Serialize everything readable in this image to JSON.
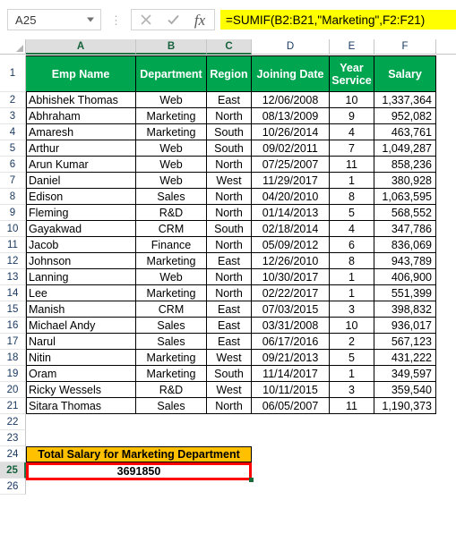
{
  "formula_bar": {
    "name_box_value": "A25",
    "cancel_icon": "cancel-x-icon",
    "confirm_icon": "confirm-check-icon",
    "fx_label": "fx",
    "formula": "=SUMIF(B2:B21,\"Marketing\",F2:F21)",
    "formula_placeholder": ""
  },
  "columns": [
    {
      "letter": "A",
      "selected": true
    },
    {
      "letter": "B",
      "selected": true
    },
    {
      "letter": "C",
      "selected": true
    },
    {
      "letter": "D",
      "selected": false
    },
    {
      "letter": "E",
      "selected": false
    },
    {
      "letter": "F",
      "selected": false
    }
  ],
  "row_numbers": [
    "1",
    "2",
    "3",
    "4",
    "5",
    "6",
    "7",
    "8",
    "9",
    "10",
    "11",
    "12",
    "13",
    "14",
    "15",
    "16",
    "17",
    "18",
    "19",
    "20",
    "21",
    "22",
    "23",
    "24",
    "25",
    "26"
  ],
  "selected_row": "25",
  "table": {
    "headers": [
      "Emp Name",
      "Department",
      "Region",
      "Joining Date",
      "Year Service",
      "Salary"
    ],
    "header_lines": [
      [
        "Emp Name"
      ],
      [
        "Department"
      ],
      [
        "Region"
      ],
      [
        "Joining Date"
      ],
      [
        "Year",
        "Service"
      ],
      [
        "Salary"
      ]
    ],
    "rows": [
      {
        "name": "Abhishek Thomas",
        "dept": "Web",
        "region": "East",
        "date": "12/06/2008",
        "years": "10",
        "salary": "1,337,364"
      },
      {
        "name": "Abhraham",
        "dept": "Marketing",
        "region": "North",
        "date": "08/13/2009",
        "years": "9",
        "salary": "952,082"
      },
      {
        "name": "Amaresh",
        "dept": "Marketing",
        "region": "South",
        "date": "10/26/2014",
        "years": "4",
        "salary": "463,761"
      },
      {
        "name": "Arthur",
        "dept": "Web",
        "region": "South",
        "date": "09/02/2011",
        "years": "7",
        "salary": "1,049,287"
      },
      {
        "name": "Arun Kumar",
        "dept": "Web",
        "region": "North",
        "date": "07/25/2007",
        "years": "11",
        "salary": "858,236"
      },
      {
        "name": "Daniel",
        "dept": "Web",
        "region": "West",
        "date": "11/29/2017",
        "years": "1",
        "salary": "380,928"
      },
      {
        "name": "Edison",
        "dept": "Sales",
        "region": "North",
        "date": "04/20/2010",
        "years": "8",
        "salary": "1,063,595"
      },
      {
        "name": "Fleming",
        "dept": "R&D",
        "region": "North",
        "date": "01/14/2013",
        "years": "5",
        "salary": "568,552"
      },
      {
        "name": "Gayakwad",
        "dept": "CRM",
        "region": "South",
        "date": "02/18/2014",
        "years": "4",
        "salary": "347,786"
      },
      {
        "name": "Jacob",
        "dept": "Finance",
        "region": "North",
        "date": "05/09/2012",
        "years": "6",
        "salary": "836,069"
      },
      {
        "name": "Johnson",
        "dept": "Marketing",
        "region": "East",
        "date": "12/26/2010",
        "years": "8",
        "salary": "943,789"
      },
      {
        "name": "Lanning",
        "dept": "Web",
        "region": "North",
        "date": "10/30/2017",
        "years": "1",
        "salary": "406,900"
      },
      {
        "name": "Lee",
        "dept": "Marketing",
        "region": "North",
        "date": "02/22/2017",
        "years": "1",
        "salary": "551,399"
      },
      {
        "name": "Manish",
        "dept": "CRM",
        "region": "East",
        "date": "07/03/2015",
        "years": "3",
        "salary": "398,832"
      },
      {
        "name": "Michael Andy",
        "dept": "Sales",
        "region": "East",
        "date": "03/31/2008",
        "years": "10",
        "salary": "936,017"
      },
      {
        "name": "Narul",
        "dept": "Sales",
        "region": "East",
        "date": "06/17/2016",
        "years": "2",
        "salary": "567,123"
      },
      {
        "name": "Nitin",
        "dept": "Marketing",
        "region": "West",
        "date": "09/21/2013",
        "years": "5",
        "salary": "431,222"
      },
      {
        "name": "Oram",
        "dept": "Marketing",
        "region": "South",
        "date": "11/14/2017",
        "years": "1",
        "salary": "349,597"
      },
      {
        "name": "Ricky Wessels",
        "dept": "R&D",
        "region": "West",
        "date": "10/11/2015",
        "years": "3",
        "salary": "359,540"
      },
      {
        "name": "Sitara Thomas",
        "dept": "Sales",
        "region": "North",
        "date": "06/05/2007",
        "years": "11",
        "salary": "1,190,373"
      }
    ]
  },
  "summary": {
    "label": "Total Salary for Marketing Department",
    "value": "3691850"
  },
  "colors": {
    "header_green": "#00a550",
    "summary_yellow": "#ffc000",
    "selection_red": "#ff0000",
    "formula_highlight": "#ffff00",
    "col_header_selected": "#dedede"
  }
}
